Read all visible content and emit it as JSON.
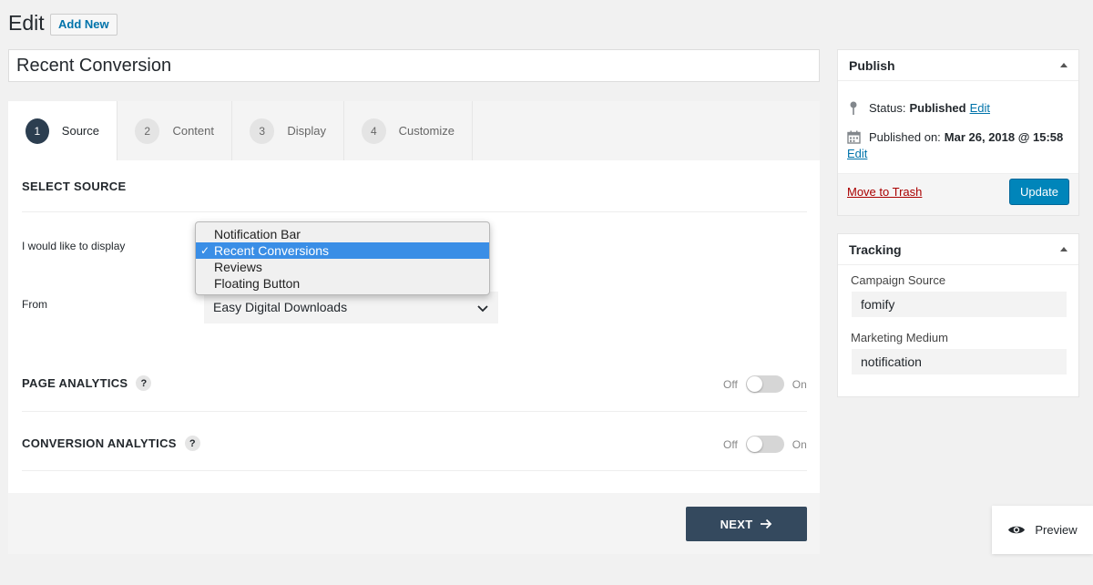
{
  "header": {
    "title": "Edit",
    "add_new": "Add New"
  },
  "post_title": "Recent Conversion",
  "tabs": [
    {
      "num": "1",
      "label": "Source"
    },
    {
      "num": "2",
      "label": "Content"
    },
    {
      "num": "3",
      "label": "Display"
    },
    {
      "num": "4",
      "label": "Customize"
    }
  ],
  "source": {
    "heading": "SELECT SOURCE",
    "display_label": "I would like to display",
    "from_label": "From",
    "from_value": "Easy Digital Downloads",
    "dropdown": {
      "options": [
        "Notification Bar",
        "Recent Conversions",
        "Reviews",
        "Floating Button"
      ],
      "selected": "Recent Conversions",
      "check": "✓"
    }
  },
  "analytics": {
    "page": {
      "label": "PAGE ANALYTICS",
      "help": "?",
      "off": "Off",
      "on": "On",
      "enabled": false
    },
    "conversion": {
      "label": "CONVERSION ANALYTICS",
      "help": "?",
      "off": "Off",
      "on": "On",
      "enabled": false
    }
  },
  "next_label": "NEXT",
  "publish": {
    "title": "Publish",
    "status_label": "Status:",
    "status_value": "Published",
    "edit": "Edit",
    "published_on_label": "Published on:",
    "published_on_value": "Mar 26, 2018 @ 15:58",
    "edit2": "Edit",
    "trash": "Move to Trash",
    "update": "Update"
  },
  "tracking": {
    "title": "Tracking",
    "campaign_source_label": "Campaign Source",
    "campaign_source_value": "fomify",
    "marketing_medium_label": "Marketing Medium",
    "marketing_medium_value": "notification"
  },
  "preview_label": "Preview",
  "colors": {
    "accent_dark": "#34495e",
    "wp_blue": "#0085ba",
    "link": "#0073aa",
    "danger": "#aa0000",
    "dropdown_selected": "#3a8ee6"
  }
}
